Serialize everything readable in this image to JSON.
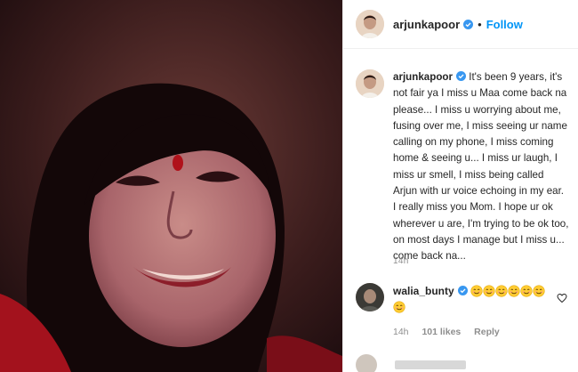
{
  "post": {
    "username": "arjunkapoor",
    "follow_label": "Follow",
    "separator": "•",
    "caption": "It's been 9 years, it's not fair ya I miss u Maa come back na please... I miss u worrying about me, fusing over me, I miss seeing ur name calling on my phone, I miss coming home & seeing u... I miss ur laugh, I miss ur smell, I miss being called Arjun with ur voice echoing in my ear. I really miss you Mom. I hope ur ok wherever u are, I'm trying to be ok too, on most days I manage but I miss u... come back na...",
    "time": "14h"
  },
  "comments": [
    {
      "username": "walia_bunty",
      "emoji_count": 7,
      "time": "14h",
      "likes": "101 likes",
      "reply_label": "Reply"
    }
  ],
  "colors": {
    "accent": "#0095f6",
    "text": "#262626",
    "muted": "#8e8e8e",
    "verified": "#3897f0"
  }
}
